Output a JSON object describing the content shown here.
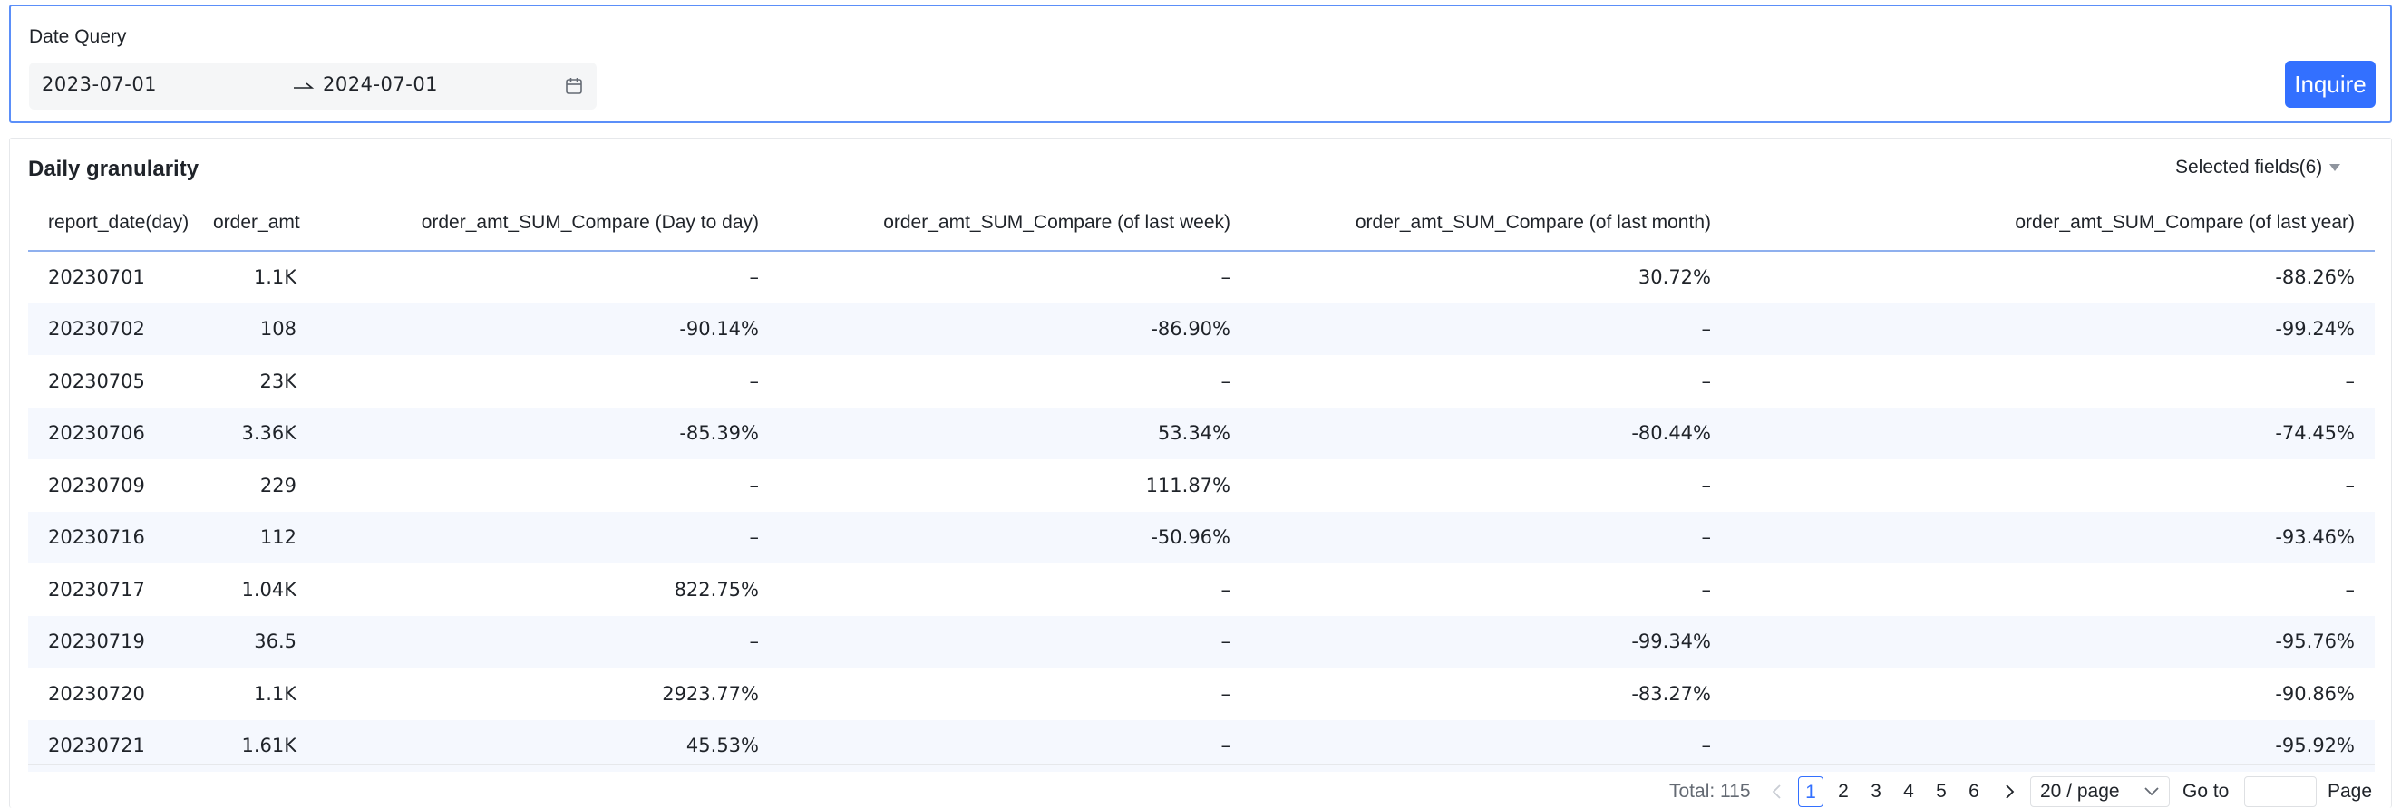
{
  "query": {
    "label": "Date Query",
    "start_date": "2023-07-01",
    "end_date": "2024-07-01",
    "inquire_label": "Inquire"
  },
  "table": {
    "title": "Daily granularity",
    "selected_fields_label": "Selected fields(6)",
    "columns": [
      "report_date(day)",
      "order_amt",
      "order_amt_SUM_Compare (Day to day)",
      "order_amt_SUM_Compare (of last week)",
      "order_amt_SUM_Compare (of last month)",
      "order_amt_SUM_Compare (of last year)"
    ],
    "rows": [
      [
        "20230701",
        "1.1K",
        "–",
        "–",
        "30.72%",
        "-88.26%"
      ],
      [
        "20230702",
        "108",
        "-90.14%",
        "-86.90%",
        "–",
        "-99.24%"
      ],
      [
        "20230705",
        "23K",
        "–",
        "–",
        "–",
        "–"
      ],
      [
        "20230706",
        "3.36K",
        "-85.39%",
        "53.34%",
        "-80.44%",
        "-74.45%"
      ],
      [
        "20230709",
        "229",
        "–",
        "111.87%",
        "–",
        "–"
      ],
      [
        "20230716",
        "112",
        "–",
        "-50.96%",
        "–",
        "-93.46%"
      ],
      [
        "20230717",
        "1.04K",
        "822.75%",
        "–",
        "–",
        "–"
      ],
      [
        "20230719",
        "36.5",
        "–",
        "–",
        "-99.34%",
        "-95.76%"
      ],
      [
        "20230720",
        "1.1K",
        "2923.77%",
        "–",
        "-83.27%",
        "-90.86%"
      ],
      [
        "20230721",
        "1.61K",
        "45.53%",
        "–",
        "–",
        "-95.92%"
      ]
    ]
  },
  "pagination": {
    "total_label": "Total: 115",
    "pages": [
      "1",
      "2",
      "3",
      "4",
      "5",
      "6"
    ],
    "current_page": "1",
    "page_size_label": "20 / page",
    "goto_label": "Go to",
    "goto_value": "",
    "page_suffix": "Page"
  },
  "colors": {
    "accent": "#3370ff",
    "panel_border": "#5b8ff9",
    "row_alt": "#f5f8fe"
  }
}
